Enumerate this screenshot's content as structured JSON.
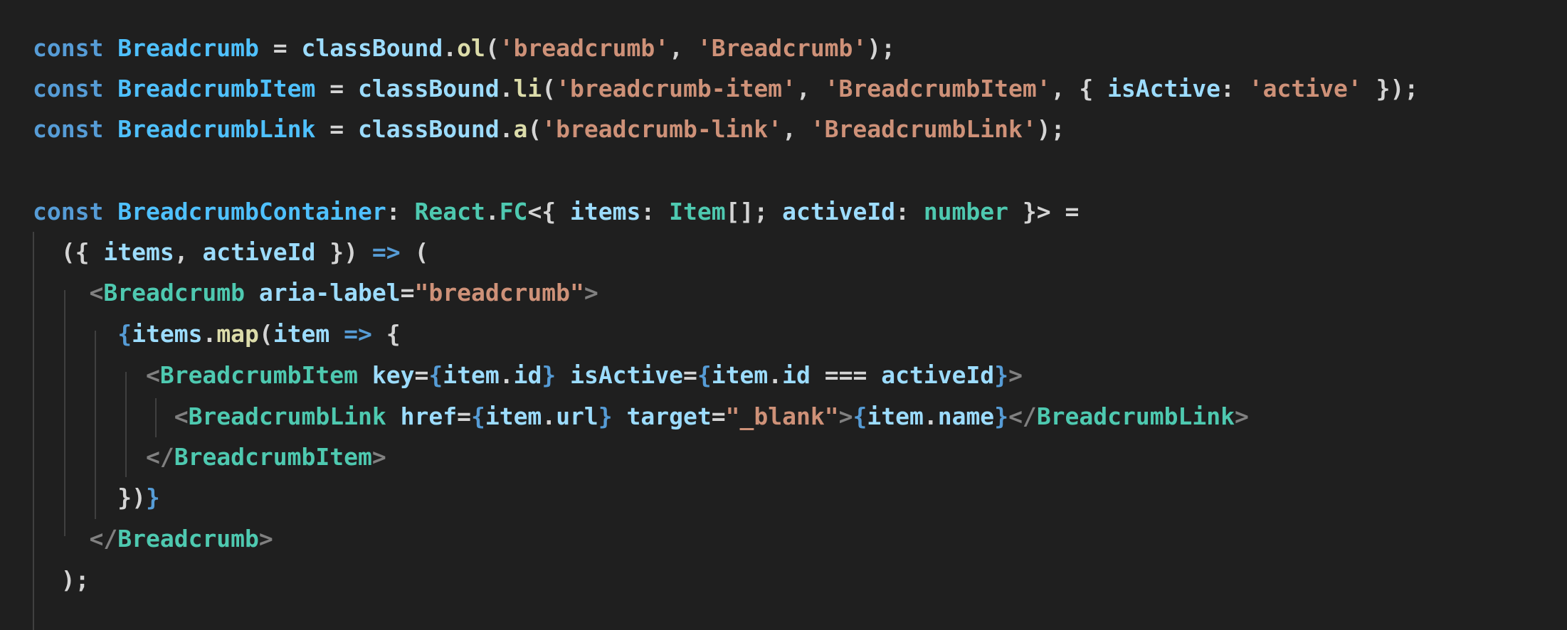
{
  "theme": {
    "background": "#1f1f1f",
    "default_text": "#d4d4d4",
    "guide": "#404040"
  },
  "code_lines": [
    [
      {
        "t": "const",
        "c": "#569cd6"
      },
      {
        "t": " ",
        "c": "#d4d4d4"
      },
      {
        "t": "Breadcrumb",
        "c": "#4fc1ff"
      },
      {
        "t": " = ",
        "c": "#d4d4d4"
      },
      {
        "t": "classBound",
        "c": "#9cdcfe"
      },
      {
        "t": ".",
        "c": "#d4d4d4"
      },
      {
        "t": "ol",
        "c": "#dcdcaa"
      },
      {
        "t": "(",
        "c": "#d4d4d4"
      },
      {
        "t": "'breadcrumb'",
        "c": "#ce9178"
      },
      {
        "t": ", ",
        "c": "#d4d4d4"
      },
      {
        "t": "'Breadcrumb'",
        "c": "#ce9178"
      },
      {
        "t": ");",
        "c": "#d4d4d4"
      }
    ],
    [
      {
        "t": "const",
        "c": "#569cd6"
      },
      {
        "t": " ",
        "c": "#d4d4d4"
      },
      {
        "t": "BreadcrumbItem",
        "c": "#4fc1ff"
      },
      {
        "t": " = ",
        "c": "#d4d4d4"
      },
      {
        "t": "classBound",
        "c": "#9cdcfe"
      },
      {
        "t": ".",
        "c": "#d4d4d4"
      },
      {
        "t": "li",
        "c": "#dcdcaa"
      },
      {
        "t": "(",
        "c": "#d4d4d4"
      },
      {
        "t": "'breadcrumb-item'",
        "c": "#ce9178"
      },
      {
        "t": ", ",
        "c": "#d4d4d4"
      },
      {
        "t": "'BreadcrumbItem'",
        "c": "#ce9178"
      },
      {
        "t": ", { ",
        "c": "#d4d4d4"
      },
      {
        "t": "isActive",
        "c": "#9cdcfe"
      },
      {
        "t": ": ",
        "c": "#d4d4d4"
      },
      {
        "t": "'active'",
        "c": "#ce9178"
      },
      {
        "t": " });",
        "c": "#d4d4d4"
      }
    ],
    [
      {
        "t": "const",
        "c": "#569cd6"
      },
      {
        "t": " ",
        "c": "#d4d4d4"
      },
      {
        "t": "BreadcrumbLink",
        "c": "#4fc1ff"
      },
      {
        "t": " = ",
        "c": "#d4d4d4"
      },
      {
        "t": "classBound",
        "c": "#9cdcfe"
      },
      {
        "t": ".",
        "c": "#d4d4d4"
      },
      {
        "t": "a",
        "c": "#dcdcaa"
      },
      {
        "t": "(",
        "c": "#d4d4d4"
      },
      {
        "t": "'breadcrumb-link'",
        "c": "#ce9178"
      },
      {
        "t": ", ",
        "c": "#d4d4d4"
      },
      {
        "t": "'BreadcrumbLink'",
        "c": "#ce9178"
      },
      {
        "t": ");",
        "c": "#d4d4d4"
      }
    ],
    [],
    [
      {
        "t": "const",
        "c": "#569cd6"
      },
      {
        "t": " ",
        "c": "#d4d4d4"
      },
      {
        "t": "BreadcrumbContainer",
        "c": "#4fc1ff"
      },
      {
        "t": ": ",
        "c": "#d4d4d4"
      },
      {
        "t": "React",
        "c": "#4ec9b0"
      },
      {
        "t": ".",
        "c": "#d4d4d4"
      },
      {
        "t": "FC",
        "c": "#4ec9b0"
      },
      {
        "t": "<{ ",
        "c": "#d4d4d4"
      },
      {
        "t": "items",
        "c": "#9cdcfe"
      },
      {
        "t": ": ",
        "c": "#d4d4d4"
      },
      {
        "t": "Item",
        "c": "#4ec9b0"
      },
      {
        "t": "[]; ",
        "c": "#d4d4d4"
      },
      {
        "t": "activeId",
        "c": "#9cdcfe"
      },
      {
        "t": ": ",
        "c": "#d4d4d4"
      },
      {
        "t": "number",
        "c": "#4ec9b0"
      },
      {
        "t": " }> =",
        "c": "#d4d4d4"
      }
    ],
    [
      {
        "t": "  ({ ",
        "c": "#d4d4d4"
      },
      {
        "t": "items",
        "c": "#9cdcfe"
      },
      {
        "t": ", ",
        "c": "#d4d4d4"
      },
      {
        "t": "activeId",
        "c": "#9cdcfe"
      },
      {
        "t": " }) ",
        "c": "#d4d4d4"
      },
      {
        "t": "=>",
        "c": "#569cd6"
      },
      {
        "t": " (",
        "c": "#d4d4d4"
      }
    ],
    [
      {
        "t": "    ",
        "c": "#d4d4d4"
      },
      {
        "t": "<",
        "c": "#808080"
      },
      {
        "t": "Breadcrumb",
        "c": "#4ec9b0"
      },
      {
        "t": " ",
        "c": "#d4d4d4"
      },
      {
        "t": "aria-label",
        "c": "#9cdcfe"
      },
      {
        "t": "=",
        "c": "#d4d4d4"
      },
      {
        "t": "\"breadcrumb\"",
        "c": "#ce9178"
      },
      {
        "t": ">",
        "c": "#808080"
      }
    ],
    [
      {
        "t": "      ",
        "c": "#d4d4d4"
      },
      {
        "t": "{",
        "c": "#569cd6"
      },
      {
        "t": "items",
        "c": "#9cdcfe"
      },
      {
        "t": ".",
        "c": "#d4d4d4"
      },
      {
        "t": "map",
        "c": "#dcdcaa"
      },
      {
        "t": "(",
        "c": "#d4d4d4"
      },
      {
        "t": "item",
        "c": "#9cdcfe"
      },
      {
        "t": " ",
        "c": "#d4d4d4"
      },
      {
        "t": "=>",
        "c": "#569cd6"
      },
      {
        "t": " {",
        "c": "#d4d4d4"
      }
    ],
    [
      {
        "t": "        ",
        "c": "#d4d4d4"
      },
      {
        "t": "<",
        "c": "#808080"
      },
      {
        "t": "BreadcrumbItem",
        "c": "#4ec9b0"
      },
      {
        "t": " ",
        "c": "#d4d4d4"
      },
      {
        "t": "key",
        "c": "#9cdcfe"
      },
      {
        "t": "=",
        "c": "#d4d4d4"
      },
      {
        "t": "{",
        "c": "#569cd6"
      },
      {
        "t": "item",
        "c": "#9cdcfe"
      },
      {
        "t": ".",
        "c": "#d4d4d4"
      },
      {
        "t": "id",
        "c": "#9cdcfe"
      },
      {
        "t": "}",
        "c": "#569cd6"
      },
      {
        "t": " ",
        "c": "#d4d4d4"
      },
      {
        "t": "isActive",
        "c": "#9cdcfe"
      },
      {
        "t": "=",
        "c": "#d4d4d4"
      },
      {
        "t": "{",
        "c": "#569cd6"
      },
      {
        "t": "item",
        "c": "#9cdcfe"
      },
      {
        "t": ".",
        "c": "#d4d4d4"
      },
      {
        "t": "id",
        "c": "#9cdcfe"
      },
      {
        "t": " === ",
        "c": "#d4d4d4"
      },
      {
        "t": "activeId",
        "c": "#9cdcfe"
      },
      {
        "t": "}",
        "c": "#569cd6"
      },
      {
        "t": ">",
        "c": "#808080"
      }
    ],
    [
      {
        "t": "          ",
        "c": "#d4d4d4"
      },
      {
        "t": "<",
        "c": "#808080"
      },
      {
        "t": "BreadcrumbLink",
        "c": "#4ec9b0"
      },
      {
        "t": " ",
        "c": "#d4d4d4"
      },
      {
        "t": "href",
        "c": "#9cdcfe"
      },
      {
        "t": "=",
        "c": "#d4d4d4"
      },
      {
        "t": "{",
        "c": "#569cd6"
      },
      {
        "t": "item",
        "c": "#9cdcfe"
      },
      {
        "t": ".",
        "c": "#d4d4d4"
      },
      {
        "t": "url",
        "c": "#9cdcfe"
      },
      {
        "t": "}",
        "c": "#569cd6"
      },
      {
        "t": " ",
        "c": "#d4d4d4"
      },
      {
        "t": "target",
        "c": "#9cdcfe"
      },
      {
        "t": "=",
        "c": "#d4d4d4"
      },
      {
        "t": "\"_blank\"",
        "c": "#ce9178"
      },
      {
        "t": ">",
        "c": "#808080"
      },
      {
        "t": "{",
        "c": "#569cd6"
      },
      {
        "t": "item",
        "c": "#9cdcfe"
      },
      {
        "t": ".",
        "c": "#d4d4d4"
      },
      {
        "t": "name",
        "c": "#9cdcfe"
      },
      {
        "t": "}",
        "c": "#569cd6"
      },
      {
        "t": "</",
        "c": "#808080"
      },
      {
        "t": "BreadcrumbLink",
        "c": "#4ec9b0"
      },
      {
        "t": ">",
        "c": "#808080"
      }
    ],
    [
      {
        "t": "        ",
        "c": "#d4d4d4"
      },
      {
        "t": "</",
        "c": "#808080"
      },
      {
        "t": "BreadcrumbItem",
        "c": "#4ec9b0"
      },
      {
        "t": ">",
        "c": "#808080"
      }
    ],
    [
      {
        "t": "      ",
        "c": "#d4d4d4"
      },
      {
        "t": "})",
        "c": "#d4d4d4"
      },
      {
        "t": "}",
        "c": "#569cd6"
      }
    ],
    [
      {
        "t": "    ",
        "c": "#d4d4d4"
      },
      {
        "t": "</",
        "c": "#808080"
      },
      {
        "t": "Breadcrumb",
        "c": "#4ec9b0"
      },
      {
        "t": ">",
        "c": "#808080"
      }
    ],
    [
      {
        "t": "  );",
        "c": "#d4d4d4"
      }
    ]
  ]
}
